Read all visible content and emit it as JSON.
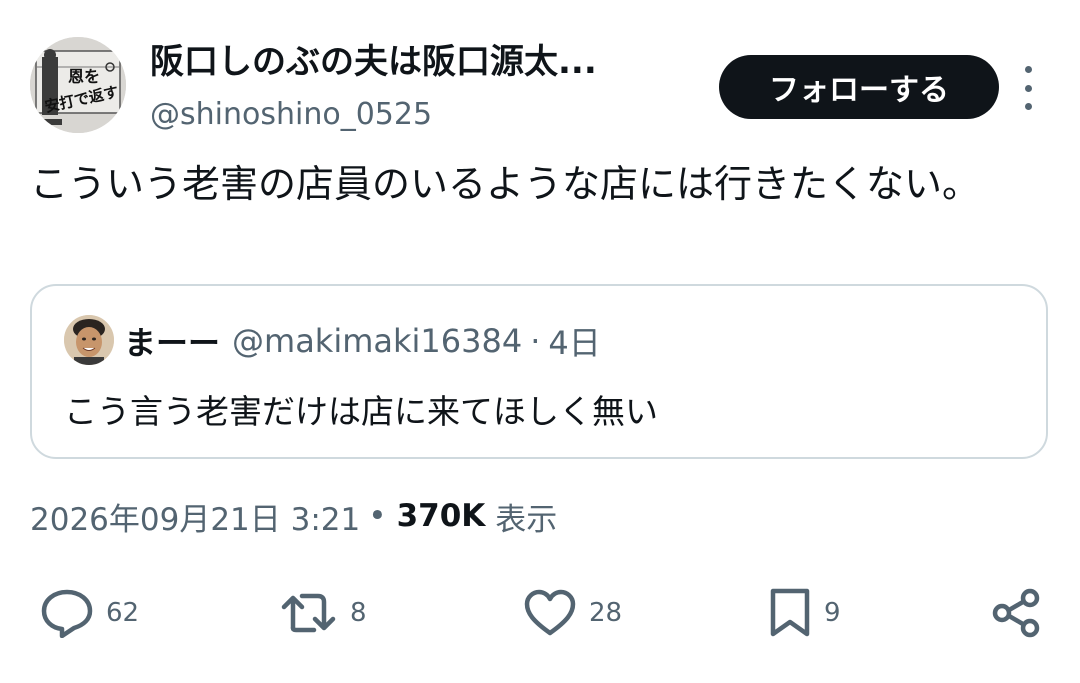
{
  "author": {
    "display_name": "阪口しのぶの夫は阪口源太...",
    "handle": "@shinoshino_0525",
    "avatar_text": [
      "恩を",
      "安打で返す"
    ]
  },
  "follow_label": "フォローする",
  "tweet_text": "こういう老害の店員のいるような店には行きたくない。",
  "quoted": {
    "display_name": "まーー",
    "handle": "@makimaki16384",
    "separator": "·",
    "time": "4日",
    "text": "こう言う老害だけは店に来てほしく無い"
  },
  "meta": {
    "datetime": "2026年09月21日 3:21",
    "dot": "•",
    "views_count": "370K",
    "views_label": "表示"
  },
  "actions": {
    "replies": "62",
    "reposts": "8",
    "likes": "28",
    "bookmarks": "9"
  },
  "colors": {
    "text_primary": "#0f1419",
    "text_secondary": "#536471",
    "border": "#cfd9de",
    "button_bg": "#0f1419"
  }
}
